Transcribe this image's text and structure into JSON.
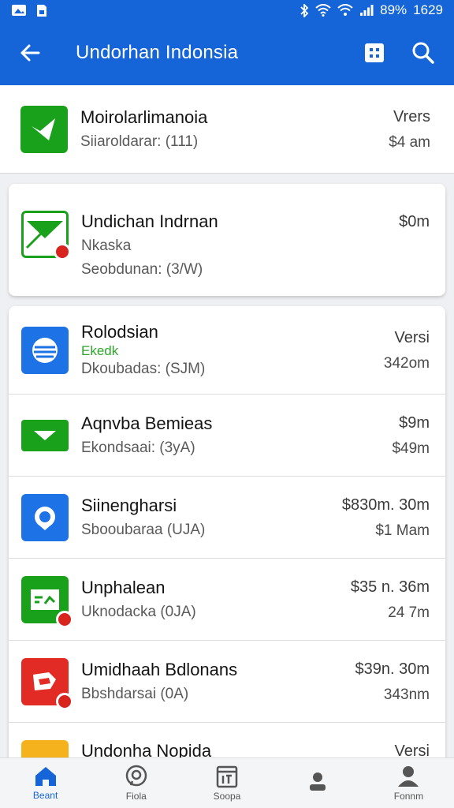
{
  "status_bar": {
    "battery": "89%",
    "time": "1629"
  },
  "app_bar": {
    "title": "Undorhan Indonsia"
  },
  "first_item": {
    "name": "Moirolarlimanoia",
    "sub": "Siiaroldarar: (111)",
    "meta_top": "Vrers",
    "meta_bottom": "$4 am"
  },
  "card_item": {
    "name": "Undichan Indrnan",
    "sub1": "Nkaska",
    "sub2": "Seobdunan: (3/W)",
    "meta_top": "$0m"
  },
  "list": [
    {
      "name": "Rolodsian",
      "tag": "Ekedk",
      "sub": "Dkoubadas: (SJM)",
      "meta_top": "Versi",
      "meta_bottom": "342om"
    },
    {
      "name": "Aqnvba Bemieas",
      "sub": "Ekondsaai: (3yA)",
      "meta_top": "$9m",
      "meta_bottom": "$49m"
    },
    {
      "name": "Siinengharsi",
      "sub": "Sbooubaraa (UJA)",
      "meta_top": "$830m. 30m",
      "meta_bottom": "$1 Mam"
    },
    {
      "name": "Unphalean",
      "sub": "Uknodacka (0JA)",
      "meta_top": "$35 n. 36m",
      "meta_bottom": "24 7m"
    },
    {
      "name": "Umidhaah Bdlonans",
      "sub": "Bbshdarsai (0A)",
      "meta_top": "$39n. 30m",
      "meta_bottom": "343nm"
    },
    {
      "name": "Undonha Nopida",
      "sub": "",
      "meta_top": "Versi",
      "meta_bottom": ""
    }
  ],
  "bottom_nav": [
    {
      "label": "Beant",
      "icon": "home-icon"
    },
    {
      "label": "Fiola",
      "icon": "chat-icon"
    },
    {
      "label": "Soopa",
      "icon": "calendar-icon"
    },
    {
      "label": "",
      "icon": "person-icon"
    },
    {
      "label": "Fonnm",
      "icon": "profile-icon"
    }
  ],
  "colors": {
    "primary": "#1565d8",
    "green": "#19a11c",
    "red": "#e22b25",
    "blue": "#1d72e6",
    "yellow": "#f6b21c"
  }
}
